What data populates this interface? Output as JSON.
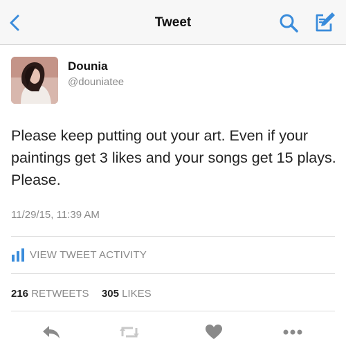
{
  "colors": {
    "accent": "#3a8cdb",
    "icon_gray": "#8a8a8a",
    "text_gray": "#8a8a8a"
  },
  "navbar": {
    "title": "Tweet",
    "icons": [
      "back-chevron-icon",
      "search-icon",
      "compose-icon"
    ]
  },
  "tweet": {
    "author_name": "Dounia",
    "author_handle": "@douniatee",
    "text": "Please keep putting out your art. Even if your paintings get 3 likes and your songs get 15 plays. Please.",
    "timestamp": "11/29/15, 11:39 AM"
  },
  "activity": {
    "label": "VIEW TWEET ACTIVITY",
    "icon": "bar-chart-icon"
  },
  "stats": {
    "retweets_count": "216",
    "retweets_label": "RETWEETS",
    "likes_count": "305",
    "likes_label": "LIKES"
  },
  "actions": {
    "icons": [
      "reply-icon",
      "retweet-icon",
      "like-icon",
      "more-icon"
    ]
  }
}
